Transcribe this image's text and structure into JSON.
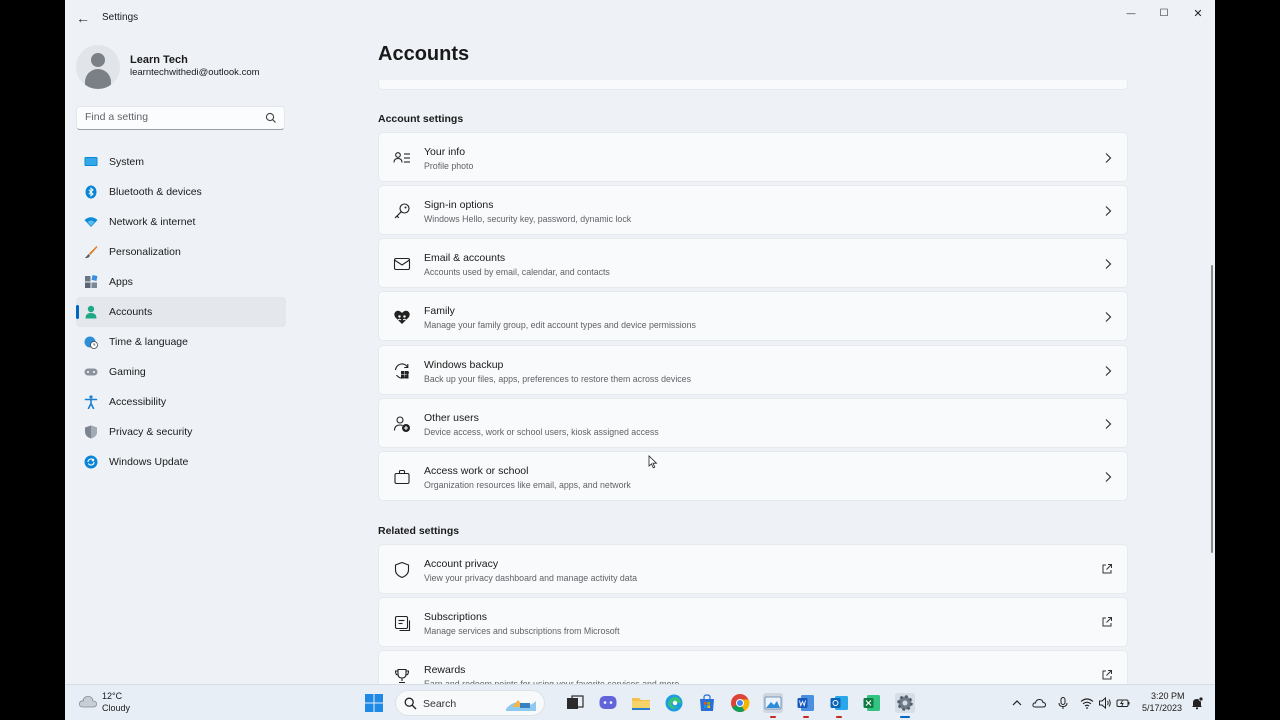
{
  "window": {
    "title": "Settings",
    "back_glyph": "←",
    "minimize_glyph": "—",
    "maximize_glyph": "☐",
    "close_glyph": "✕"
  },
  "profile": {
    "name": "Learn Tech",
    "email": "learntechwithedi@outlook.com"
  },
  "search": {
    "placeholder": "Find a setting"
  },
  "sidebar": {
    "items": [
      {
        "label": "System",
        "icon": "system-icon",
        "active": false
      },
      {
        "label": "Bluetooth & devices",
        "icon": "bluetooth-icon",
        "active": false
      },
      {
        "label": "Network & internet",
        "icon": "wifi-icon",
        "active": false
      },
      {
        "label": "Personalization",
        "icon": "brush-icon",
        "active": false
      },
      {
        "label": "Apps",
        "icon": "apps-icon",
        "active": false
      },
      {
        "label": "Accounts",
        "icon": "accounts-icon",
        "active": true
      },
      {
        "label": "Time & language",
        "icon": "globe-clock-icon",
        "active": false
      },
      {
        "label": "Gaming",
        "icon": "gamepad-icon",
        "active": false
      },
      {
        "label": "Accessibility",
        "icon": "accessibility-icon",
        "active": false
      },
      {
        "label": "Privacy & security",
        "icon": "shield-icon",
        "active": false
      },
      {
        "label": "Windows Update",
        "icon": "update-icon",
        "active": false
      }
    ]
  },
  "main": {
    "title": "Accounts",
    "account_settings": {
      "heading": "Account settings",
      "items": [
        {
          "title": "Your info",
          "subtitle": "Profile photo",
          "icon": "person-info-icon"
        },
        {
          "title": "Sign-in options",
          "subtitle": "Windows Hello, security key, password, dynamic lock",
          "icon": "key-icon"
        },
        {
          "title": "Email & accounts",
          "subtitle": "Accounts used by email, calendar, and contacts",
          "icon": "mail-icon"
        },
        {
          "title": "Family",
          "subtitle": "Manage your family group, edit account types and device permissions",
          "icon": "family-heart-icon"
        },
        {
          "title": "Windows backup",
          "subtitle": "Back up your files, apps, preferences to restore them across devices",
          "icon": "backup-icon"
        },
        {
          "title": "Other users",
          "subtitle": "Device access, work or school users, kiosk assigned access",
          "icon": "add-user-icon"
        },
        {
          "title": "Access work or school",
          "subtitle": "Organization resources like email, apps, and network",
          "icon": "briefcase-icon"
        }
      ]
    },
    "related_settings": {
      "heading": "Related settings",
      "items": [
        {
          "title": "Account privacy",
          "subtitle": "View your privacy dashboard and manage activity data",
          "icon": "shield-outline-icon"
        },
        {
          "title": "Subscriptions",
          "subtitle": "Manage services and subscriptions from Microsoft",
          "icon": "subscriptions-icon"
        },
        {
          "title": "Rewards",
          "subtitle": "Earn and redeem points for using your favorite services and more",
          "icon": "trophy-icon"
        }
      ]
    }
  },
  "taskbar": {
    "weather_temp": "12°C",
    "weather_condition": "Cloudy",
    "search_label": "Search",
    "time": "3:20 PM",
    "date": "5/17/2023",
    "accent": "#0067c0"
  }
}
